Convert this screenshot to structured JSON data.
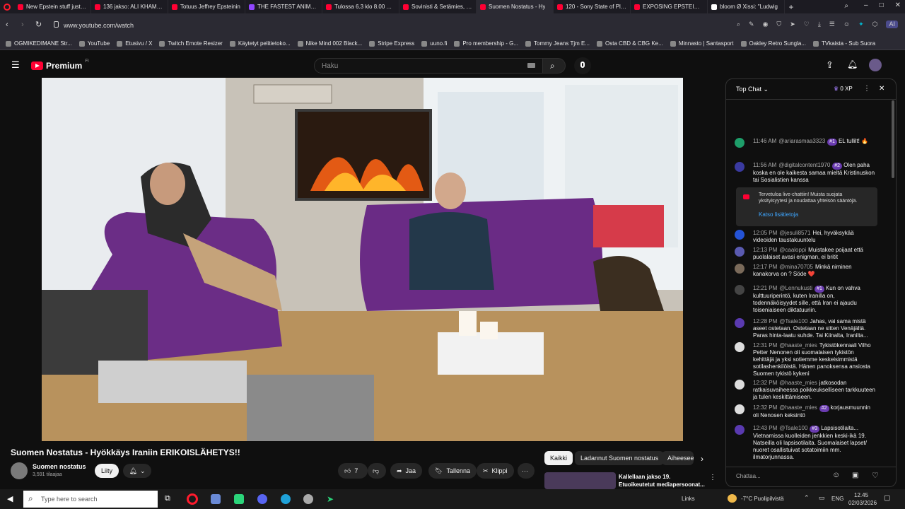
{
  "browser": {
    "tabs": [
      {
        "title": "New Epstein stuff just dr",
        "color": "#ff0033"
      },
      {
        "title": "136 jakso: ALI KHAMENE",
        "color": "#ff0033"
      },
      {
        "title": "Totuus Jeffrey Epsteinin",
        "color": "#ff0033"
      },
      {
        "title": "THE FASTEST ANIMATRO",
        "color": "#9146ff"
      },
      {
        "title": "Tulossa 6.3 klo 8.00 Aleks",
        "color": "#ff0033"
      },
      {
        "title": "Sovinisti & Setämies, jaks",
        "color": "#ff0033"
      },
      {
        "title": "Suomen Nostatus - Hy",
        "color": "#ff0033",
        "active": true
      },
      {
        "title": "120 - Sony State of Play 2",
        "color": "#ff0033"
      },
      {
        "title": "EXPOSING EPSTEIN'S ZO",
        "color": "#ff0033"
      },
      {
        "title": "bloom Ø Xissi: \"Ludwig",
        "color": "#ffffff"
      }
    ],
    "url": "www.youtube.com/watch",
    "bookmarks": [
      "OGMIKEDIMANE Str...",
      "YouTube",
      "Etusivu / X",
      "Twitch Emote Resizer",
      "Käytetyt pelitietoko...",
      "Nike Mind 002 Black...",
      "Stripe Express",
      "uuno.fi",
      "Pro membership - G...",
      "Tommy Jeans Tjm E...",
      "Osta CBD & CBG Ke...",
      "Minnasto | Santasport",
      "Oakley Retro Sungla...",
      "TVkaista - Sub Suora"
    ]
  },
  "yt": {
    "brand": "Premium",
    "brand_sup": "FI",
    "search_placeholder": "Haku"
  },
  "video": {
    "title": "Suomen Nostatus - Hyökkäys Iraniin ERIKOISLÄHETYS!!",
    "channel": "Suomen nostatus",
    "subs": "3,591 tilaajaa",
    "join": "Liity",
    "likes": "7",
    "share": "Jaa",
    "save": "Tallenna",
    "clip": "Klippi"
  },
  "related": {
    "chips": [
      "Kaikki",
      "Ladannut Suomen nostatus",
      "Aiheeseen"
    ],
    "first_title": "Kallellaan jakso 19. Etuoikeutetut mediapersoonat..."
  },
  "chat": {
    "header": "Top Chat",
    "xp": "0 XP",
    "input_placeholder": "Chattaa...",
    "welcome": "Tervetuloa live-chattiin! Muista suojata yksityisyytesi ja noudattaa yhteisön sääntöjä.",
    "welcome_link": "Katso lisätietoja",
    "messages": [
      {
        "time": "11:46 AM",
        "author": "@ariarasmaa3323",
        "badge": "#1",
        "text": "EL tullilt! 🔥",
        "avatar": "#1e9e6a"
      },
      {
        "time": "11:56 AM",
        "author": "@digitalcontent1970",
        "badge": "#2",
        "text": "Olen paha koska en ole kaikesta samaa mieltä Kristinuskon tai Sosialistien kanssa",
        "avatar": "#3a3aa0"
      },
      {
        "time": "12:05 PM",
        "author": "@jesuli8571",
        "badge": "",
        "text": "Hei, hyväksykää videoiden taustakuuntelu",
        "avatar": "#2453d6"
      },
      {
        "time": "12:13 PM",
        "author": "@caaloppi",
        "badge": "",
        "text": "Muistakee poijaat että puolalaiset avasi enigman, ei britit",
        "avatar": "#5a5ab0"
      },
      {
        "time": "12:17 PM",
        "author": "@mina70705",
        "badge": "",
        "text": "Minkä niminen kanakorva on ? Söde ❤️",
        "avatar": "#7a6a5a"
      },
      {
        "time": "12:21 PM",
        "author": "@Lennukusti",
        "badge": "#1",
        "text": "Kun on vahva kulttuuriperintö, kuten Iranilla on, todennäköisyydet sille, että Iran ei ajaudu toiseniaiseen diktatuuriin.",
        "avatar": "#444"
      },
      {
        "time": "12:28 PM",
        "author": "@Tsale100",
        "badge": "",
        "text": "Jahas, vai sama mistä aseet ostetaan. Ostetaan ne sitten Venäjältä. Paras hinta-laatu suhde. Tai Kiinalta, Iranilta...",
        "avatar": "#5a3ab0"
      },
      {
        "time": "12:31 PM",
        "author": "@haaste_mies",
        "badge": "",
        "text": "Tykistökenraali Vilho Petter Nenonen oli suomalaisen tykistön kehittäjä ja yksi sotiemme keskeisimmistä sotilashenkilöistä. Hänen panoksensa ansiosta Suomen tykistö kykeni",
        "avatar": "#ddd"
      },
      {
        "time": "12:32 PM",
        "author": "@haaste_mies",
        "badge": "",
        "text": "jatkosodan ratkaisuvaiheessa poikkeukselliseen tarkkuuteen ja tulen keskittämiseen.",
        "avatar": "#ddd"
      },
      {
        "time": "12:32 PM",
        "author": "@haaste_mies",
        "badge": "#2",
        "text": "korjausmuunnin oli Nenosen keksintö",
        "avatar": "#ddd"
      },
      {
        "time": "12:43 PM",
        "author": "@Tsale100",
        "badge": "#3",
        "text": "Lapsisotilaita... Vietnamissa kuolleiden jenkkien keski-ikä 19. Natseilla oli lapsisotilaita. Suomalaiset lapset/ nuoret osallistuivat sotatoimiin mm. ilmatorjunnassa.",
        "avatar": "#5a3ab0"
      }
    ]
  },
  "taskbar": {
    "search_placeholder": "Type here to search",
    "links": "Links",
    "weather": "-7°C Puolipilvistä",
    "lang": "ENG",
    "time": "12.45",
    "date": "02/03/2026"
  }
}
